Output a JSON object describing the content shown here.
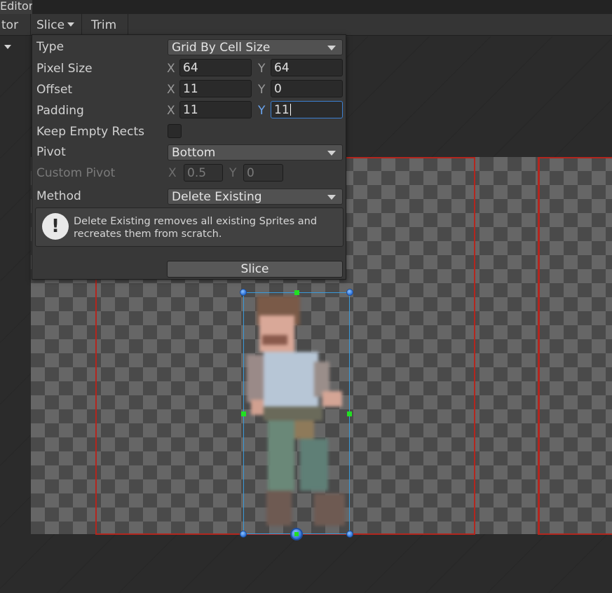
{
  "window": {
    "title": "Editor"
  },
  "toolbar": {
    "editor_dropdown_label": "tor",
    "slice_label": "Slice",
    "trim_label": "Trim"
  },
  "slice_popup": {
    "type": {
      "label": "Type",
      "value": "Grid By Cell Size"
    },
    "pixel_size": {
      "label": "Pixel Size",
      "x_axis": "X",
      "x": "64",
      "y_axis": "Y",
      "y": "64"
    },
    "offset": {
      "label": "Offset",
      "x_axis": "X",
      "x": "11",
      "y_axis": "Y",
      "y": "0"
    },
    "padding": {
      "label": "Padding",
      "x_axis": "X",
      "x": "11",
      "y_axis": "Y",
      "y": "11"
    },
    "keep_empty_rects": {
      "label": "Keep Empty Rects",
      "checked": false
    },
    "pivot": {
      "label": "Pivot",
      "value": "Bottom"
    },
    "custom_pivot": {
      "label": "Custom Pivot",
      "x_axis": "X",
      "x": "0.5",
      "y_axis": "Y",
      "y": "0"
    },
    "method": {
      "label": "Method",
      "value": "Delete Existing"
    },
    "help_text": "Delete Existing removes all existing Sprites and recreates them from scratch.",
    "slice_button": "Slice"
  },
  "colors": {
    "slice_rect": "#b3261e",
    "selection": "#3a9ad9",
    "handle": "#2a6fd6",
    "side_handle": "#22e022"
  },
  "icons": {
    "help": "exclamation-icon"
  }
}
